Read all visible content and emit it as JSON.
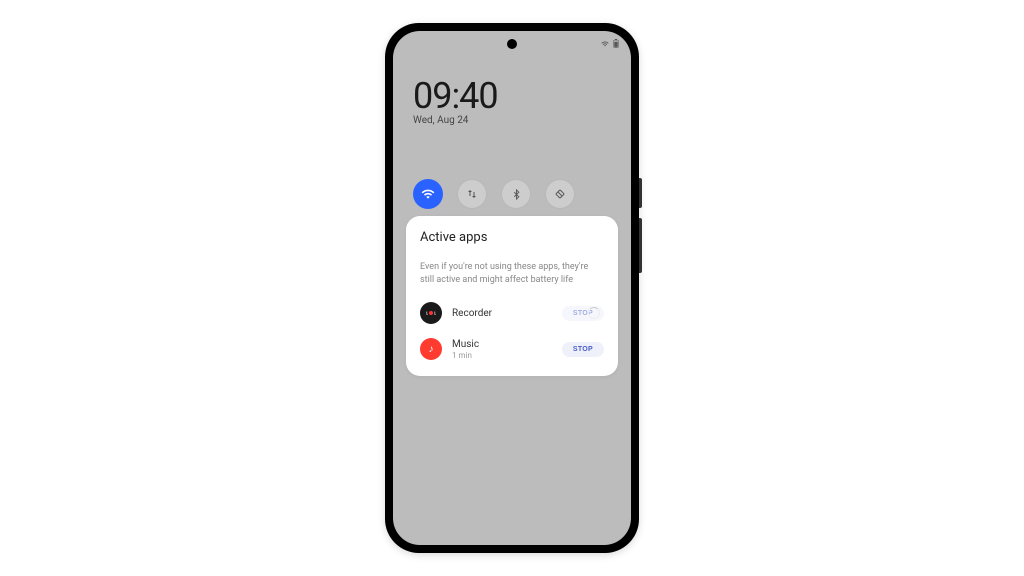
{
  "clock": {
    "time": "09:40",
    "date": "Wed,  Aug  24"
  },
  "card": {
    "title": "Active apps",
    "description": "Even if you're not using these apps, they're still active and might affect battery life"
  },
  "apps": [
    {
      "name": "Recorder",
      "sub": "",
      "button": "STOP",
      "loading": true,
      "icon": "recorder"
    },
    {
      "name": "Music",
      "sub": "1 min",
      "button": "STOP",
      "loading": false,
      "icon": "music"
    }
  ],
  "quick_settings": [
    {
      "id": "wifi",
      "active": true
    },
    {
      "id": "data",
      "active": false
    },
    {
      "id": "bluetooth",
      "active": false
    },
    {
      "id": "rotation",
      "active": false
    }
  ]
}
